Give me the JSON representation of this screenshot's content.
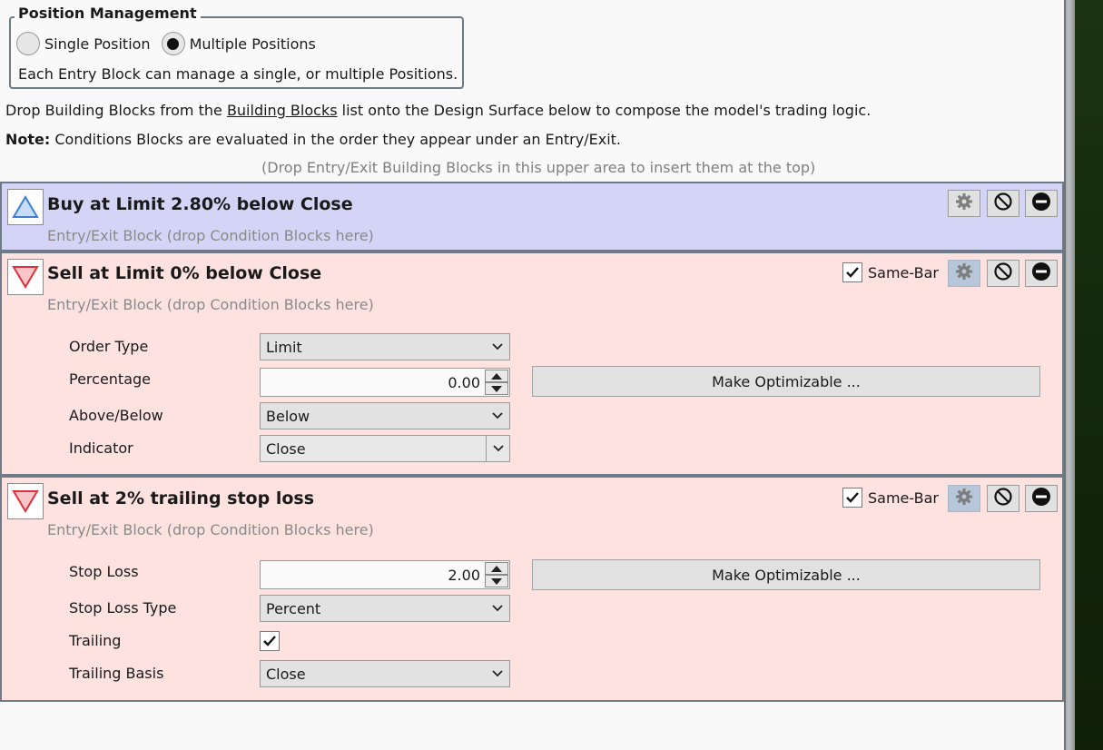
{
  "position_management": {
    "legend": "Position Management",
    "options": [
      {
        "label": "Single Position",
        "selected": false
      },
      {
        "label": "Multiple Positions",
        "selected": true
      }
    ],
    "description": "Each Entry Block can manage a single, or multiple Positions."
  },
  "instructions": {
    "prefix": "Drop Building Blocks from the ",
    "link": "Building Blocks",
    "suffix": " list onto the Design Surface below to compose the model's trading logic.",
    "note_label": "Note:",
    "note_text": " Conditions Blocks are evaluated in the order they appear under an Entry/Exit.",
    "drop_hint": "(Drop Entry/Exit Building Blocks in this upper area to insert them at the top)"
  },
  "blocks": [
    {
      "title": "Buy at Limit 2.80% below Close",
      "subtitle": "Entry/Exit Block (drop Condition Blocks here)",
      "icon": "triangle-up-icon"
    },
    {
      "title": "Sell at Limit 0% below Close",
      "subtitle": "Entry/Exit Block (drop Condition Blocks here)",
      "icon": "triangle-down-icon",
      "same_bar_label": "Same-Bar",
      "same_bar_checked": true,
      "params": {
        "order_type_label": "Order Type",
        "order_type_value": "Limit",
        "percentage_label": "Percentage",
        "percentage_value": "0.00",
        "above_below_label": "Above/Below",
        "above_below_value": "Below",
        "indicator_label": "Indicator",
        "indicator_value": "Close",
        "optimize_label": "Make Optimizable ..."
      }
    },
    {
      "title": "Sell at 2% trailing stop loss",
      "subtitle": "Entry/Exit Block (drop Condition Blocks here)",
      "icon": "triangle-down-icon",
      "same_bar_label": "Same-Bar",
      "same_bar_checked": true,
      "params": {
        "stop_loss_label": "Stop Loss",
        "stop_loss_value": "2.00",
        "stop_loss_type_label": "Stop Loss Type",
        "stop_loss_type_value": "Percent",
        "trailing_label": "Trailing",
        "trailing_checked": true,
        "trailing_basis_label": "Trailing Basis",
        "trailing_basis_value": "Close",
        "optimize_label": "Make Optimizable ..."
      }
    }
  ],
  "colors": {
    "buy_block_bg": "#d4d4f6",
    "sell_block_bg": "#fde2e0",
    "buy_icon": "#3d7fd0",
    "sell_icon": "#e0303c",
    "side_panel": "#152a0c"
  }
}
